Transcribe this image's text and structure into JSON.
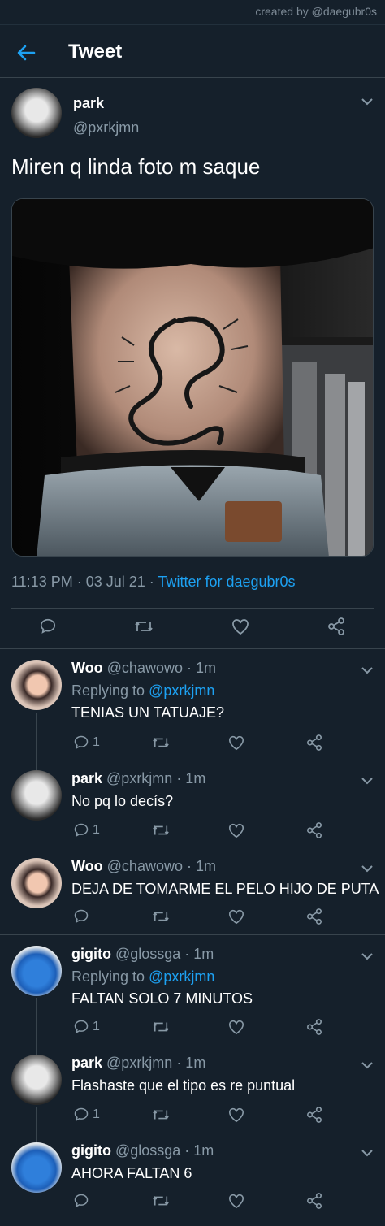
{
  "watermark": "created by @daegubr0s",
  "header": {
    "title": "Tweet",
    "back_icon": "arrow-left-icon"
  },
  "main_tweet": {
    "name": "park",
    "handle": "@pxrkjmn",
    "text": "Miren q linda foto m saque",
    "image_description": "dragon-tattoo-photo",
    "time": "11:13 PM · 03 Jul 21 · ",
    "source": "Twitter for daegubr0s",
    "actions": [
      "comment-icon",
      "retweet-icon",
      "like-icon",
      "share-icon"
    ]
  },
  "replies": [
    {
      "name": "Woo",
      "meta": " @chawowo · 1m",
      "replying_prefix": "Replying to ",
      "replying_to": "@pxrkjmn",
      "text": "TENIAS UN TATUAJE?",
      "reply_count": "1"
    },
    {
      "name": "park",
      "meta": " @pxrkjmn · 1m",
      "text": "No pq lo decís?",
      "reply_count": "1"
    },
    {
      "name": "Woo",
      "meta": " @chawowo · 1m",
      "text": "DEJA DE TOMARME EL PELO HIJO DE PUTA",
      "reply_count": ""
    },
    {
      "name": "gigito",
      "meta": " @glossga · 1m",
      "replying_prefix": "Replying to ",
      "replying_to": "@pxrkjmn",
      "text": "FALTAN SOLO 7 MINUTOS",
      "reply_count": "1"
    },
    {
      "name": "park",
      "meta": " @pxrkjmn · 1m",
      "text": "Flashaste que el tipo es re puntual",
      "reply_count": "1"
    },
    {
      "name": "gigito",
      "meta": " @glossga · 1m",
      "text": "AHORA FALTAN 6",
      "reply_count": ""
    }
  ],
  "colors": {
    "background": "#15202b",
    "accent": "#1da1f2",
    "secondary_text": "#8899a6",
    "border": "#38444d"
  }
}
